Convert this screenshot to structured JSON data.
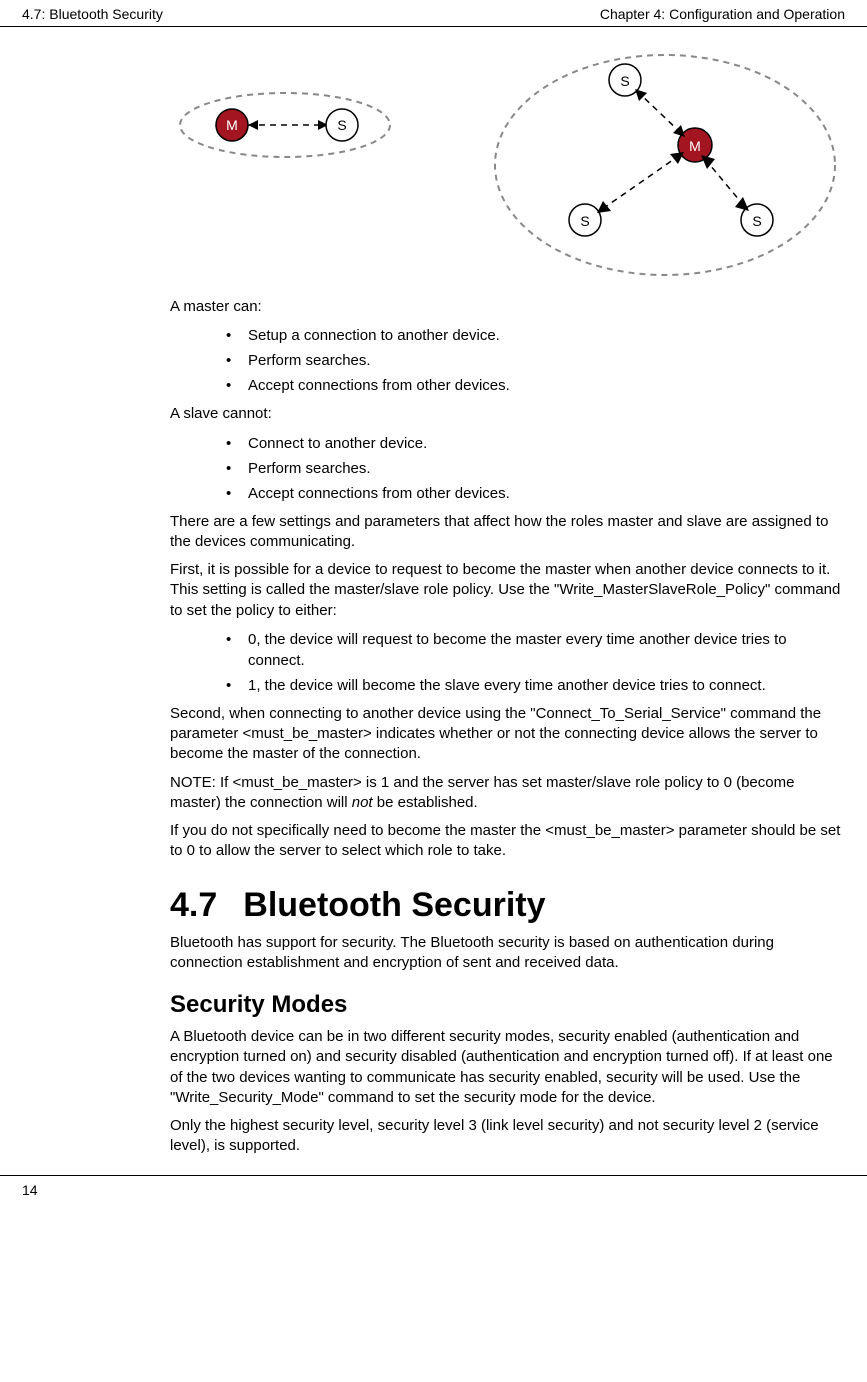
{
  "header": {
    "left": "4.7: Bluetooth Security",
    "right": "Chapter 4: Configuration and Operation"
  },
  "diagram": {
    "m": "M",
    "s": "S"
  },
  "body": {
    "p1": "A master can:",
    "master_list": [
      "Setup a connection to another device.",
      "Perform searches.",
      "Accept connections from other devices."
    ],
    "p2": "A slave cannot:",
    "slave_list": [
      "Connect to another device.",
      "Perform searches.",
      "Accept connections from other devices."
    ],
    "p3": "There are a few settings and parameters that affect how the roles master and slave are assigned to the devices communicating.",
    "p4": "First, it is possible for a device to request to become the master when another device connects to it. This setting is called the master/slave role policy. Use the \"Write_MasterSlaveRole_Policy\" command to set the policy to either:",
    "policy_list": [
      "0, the device will request to become the master every time another device tries to connect.",
      "1, the device will become the slave every time another device tries to connect."
    ],
    "p5": "Second, when connecting to another device using the \"Connect_To_Serial_Service\" command the parameter <must_be_master> indicates whether or not the connecting device allows the server to become the master of the connection.",
    "p6a": "NOTE: If <must_be_master> is 1 and the server has set master/slave role policy to 0 (become master) the connection will ",
    "p6em": "not",
    "p6b": " be established.",
    "p7": "If you do not specifically need to become the master the <must_be_master> parameter should be set to 0 to allow the server to select which role to take."
  },
  "section": {
    "num": "4.7",
    "title": "Bluetooth Security",
    "intro": "Bluetooth has support for security. The Bluetooth security is based on authentication during connection establishment and encryption of sent and received data."
  },
  "subsection": {
    "title": "Security Modes",
    "p1": "A Bluetooth device can be in two different security modes, security enabled (authentication and encryption turned on) and security disabled (authentication and encryption turned off). If at least one of the two devices wanting to communicate has security enabled, security will be used. Use the \"Write_Security_Mode\" command to set the security mode for the device.",
    "p2": "Only the highest security level, security level 3 (link level security) and not security level 2 (service level), is supported."
  },
  "footer": {
    "page": "14"
  }
}
